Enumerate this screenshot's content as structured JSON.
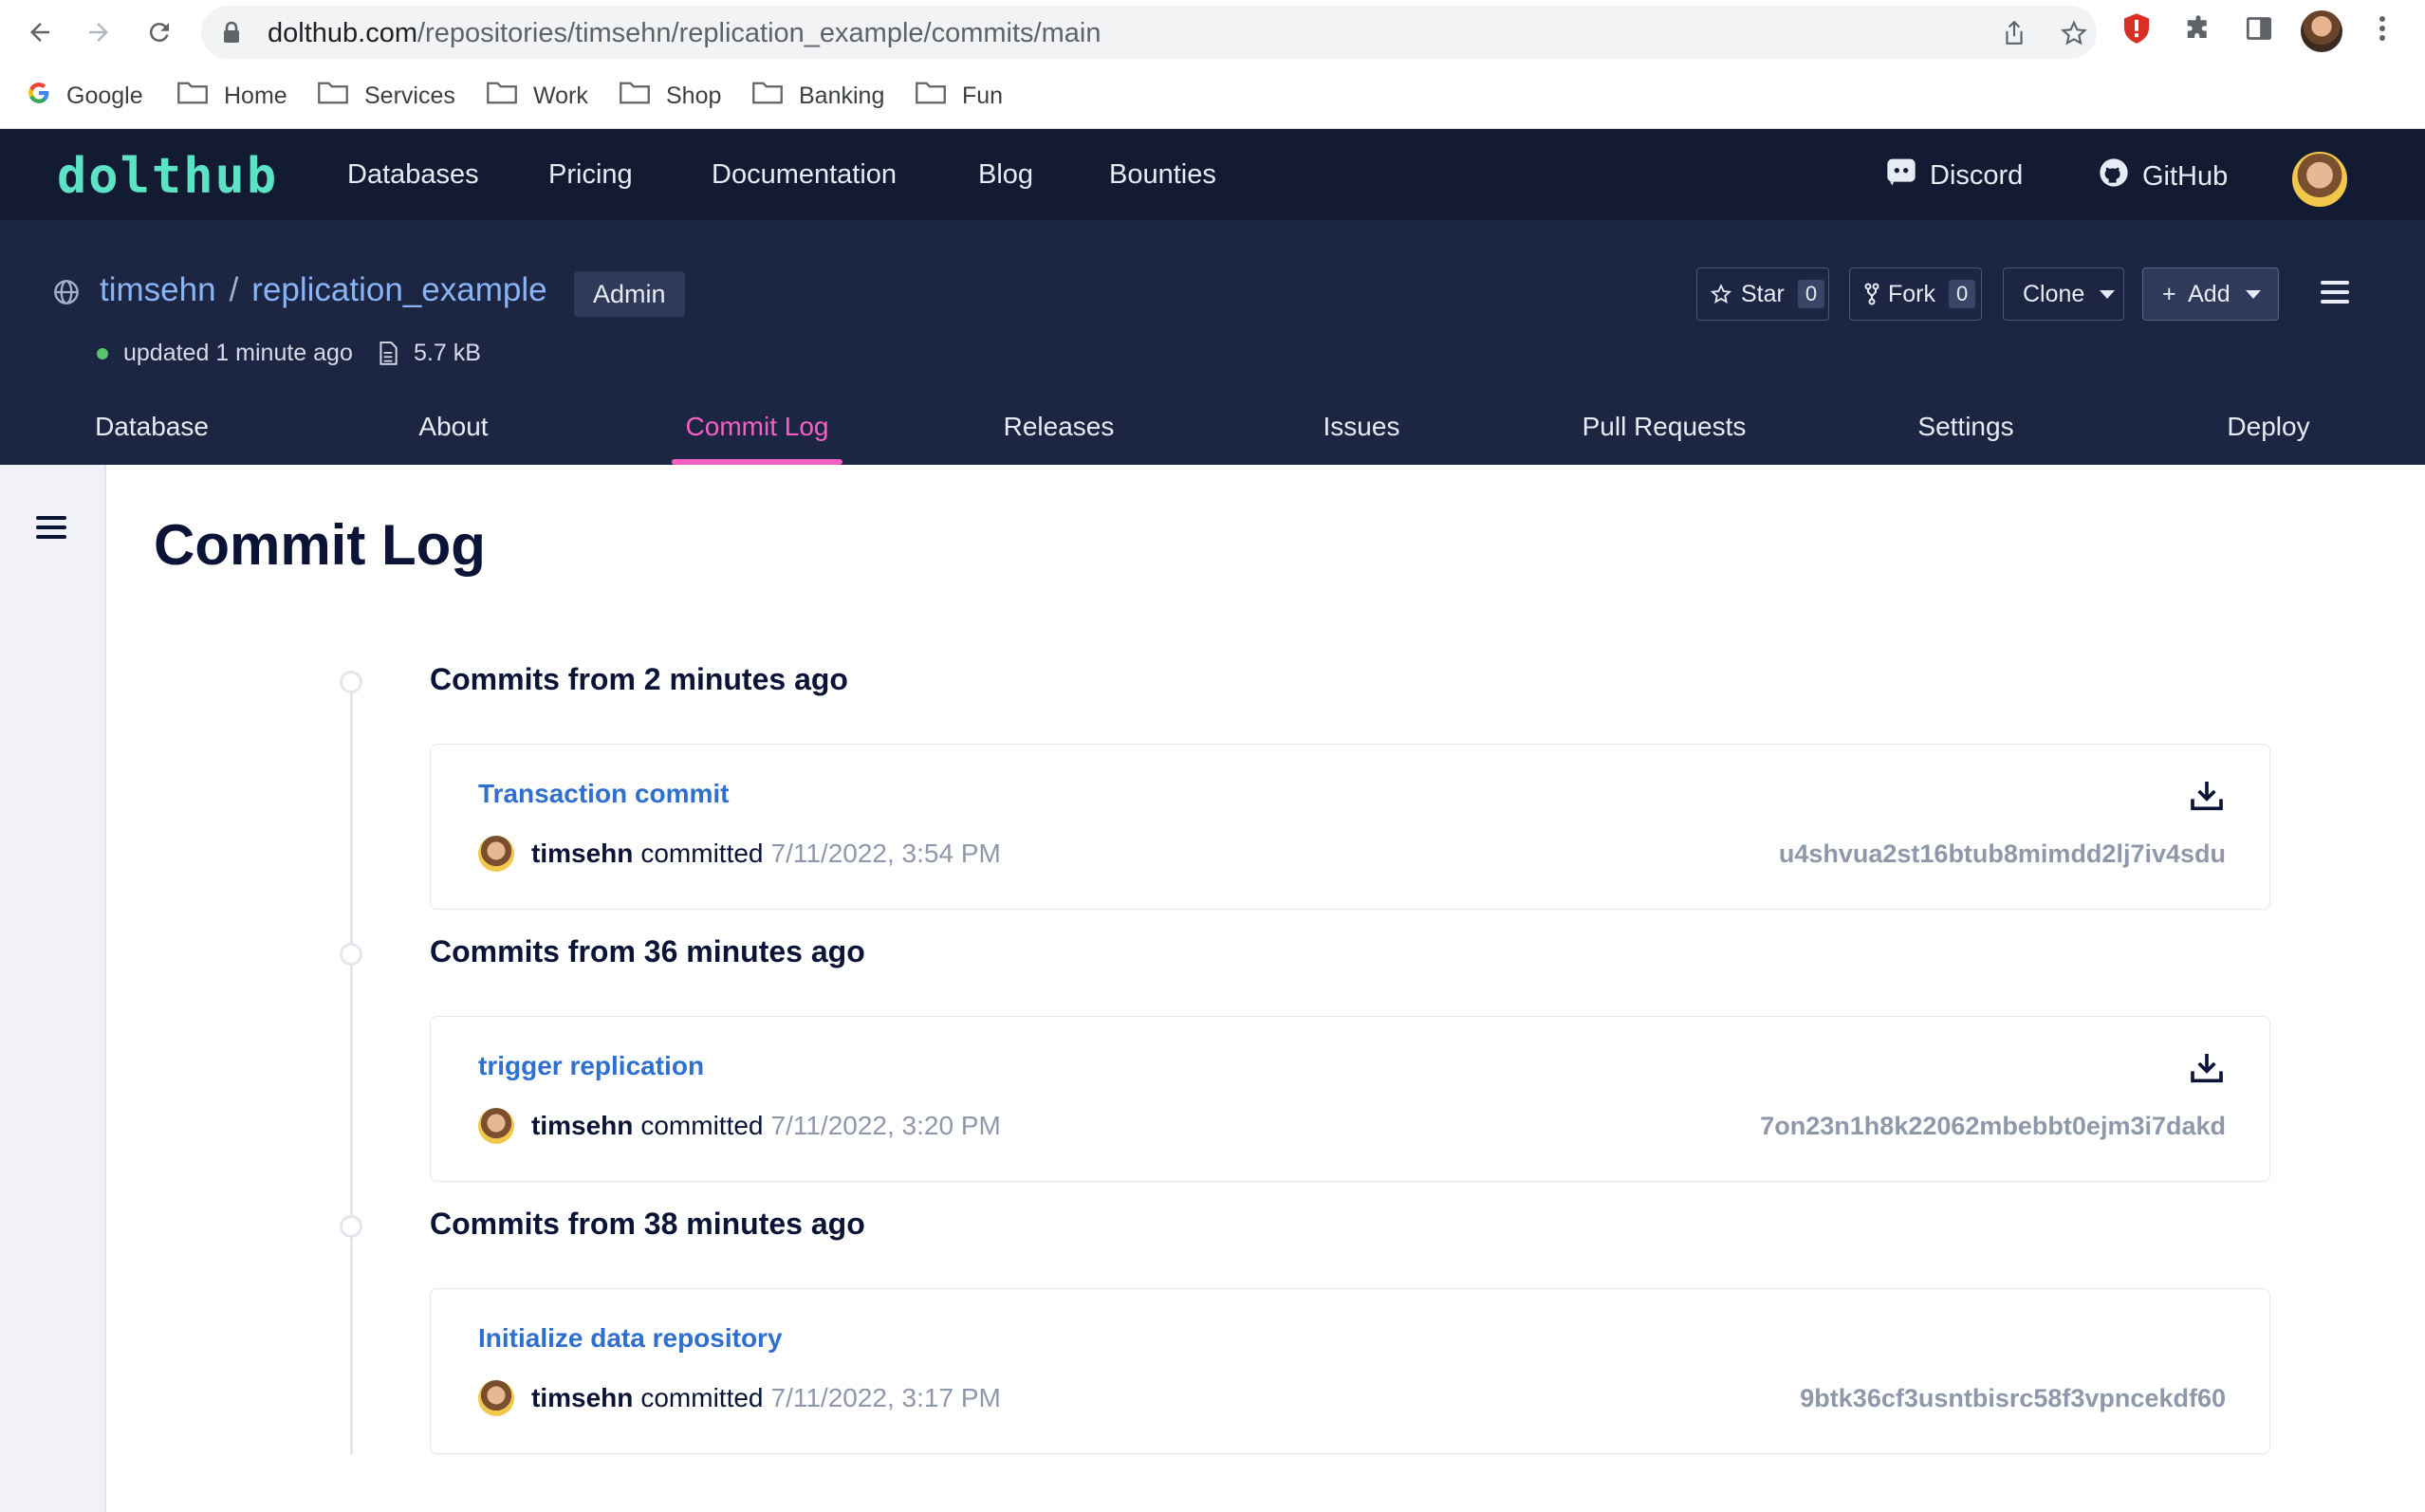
{
  "browser": {
    "url_host": "dolthub.com",
    "url_path": "/repositories/timsehn/replication_example/commits/main",
    "bookmarks": [
      {
        "label": "Google"
      },
      {
        "label": "Home"
      },
      {
        "label": "Services"
      },
      {
        "label": "Work"
      },
      {
        "label": "Shop"
      },
      {
        "label": "Banking"
      },
      {
        "label": "Fun"
      }
    ]
  },
  "header": {
    "logo": "dolthub",
    "nav": [
      "Databases",
      "Pricing",
      "Documentation",
      "Blog",
      "Bounties"
    ],
    "discord": "Discord",
    "github": "GitHub"
  },
  "repo": {
    "owner": "timsehn",
    "separator": "/",
    "name": "replication_example",
    "role_badge": "Admin",
    "updated": "updated 1 minute ago",
    "size": "5.7 kB",
    "star_label": "Star",
    "star_count": "0",
    "fork_label": "Fork",
    "fork_count": "0",
    "clone_label": "Clone",
    "add_label": "+  Add",
    "tabs": [
      "Database",
      "About",
      "Commit Log",
      "Releases",
      "Issues",
      "Pull Requests",
      "Settings",
      "Deploy"
    ],
    "active_tab": "Commit Log"
  },
  "main": {
    "title": "Commit Log",
    "groups": [
      {
        "heading": "Commits from 2 minutes ago",
        "commits": [
          {
            "message": "Transaction commit",
            "author": "timsehn",
            "verb": "committed",
            "date": "7/11/2022, 3:54 PM",
            "hash": "u4shvua2st16btub8mimdd2lj7iv4sdu"
          }
        ]
      },
      {
        "heading": "Commits from 36 minutes ago",
        "commits": [
          {
            "message": "trigger replication",
            "author": "timsehn",
            "verb": "committed",
            "date": "7/11/2022, 3:20 PM",
            "hash": "7on23n1h8k22062mbebbt0ejm3i7dakd"
          }
        ]
      },
      {
        "heading": "Commits from 38 minutes ago",
        "commits": [
          {
            "message": "Initialize data repository",
            "author": "timsehn",
            "verb": "committed",
            "date": "7/11/2022, 3:17 PM",
            "hash": "9btk36cf3usntbisrc58f3vpncekdf60"
          }
        ]
      }
    ]
  },
  "colors": {
    "nav_bg": "#131b33",
    "repo_header_bg": "#1c2541",
    "logo": "#5ce2c5",
    "active_tab": "#f360c4",
    "link": "#2e6fcf",
    "muted": "#8f98aa"
  }
}
